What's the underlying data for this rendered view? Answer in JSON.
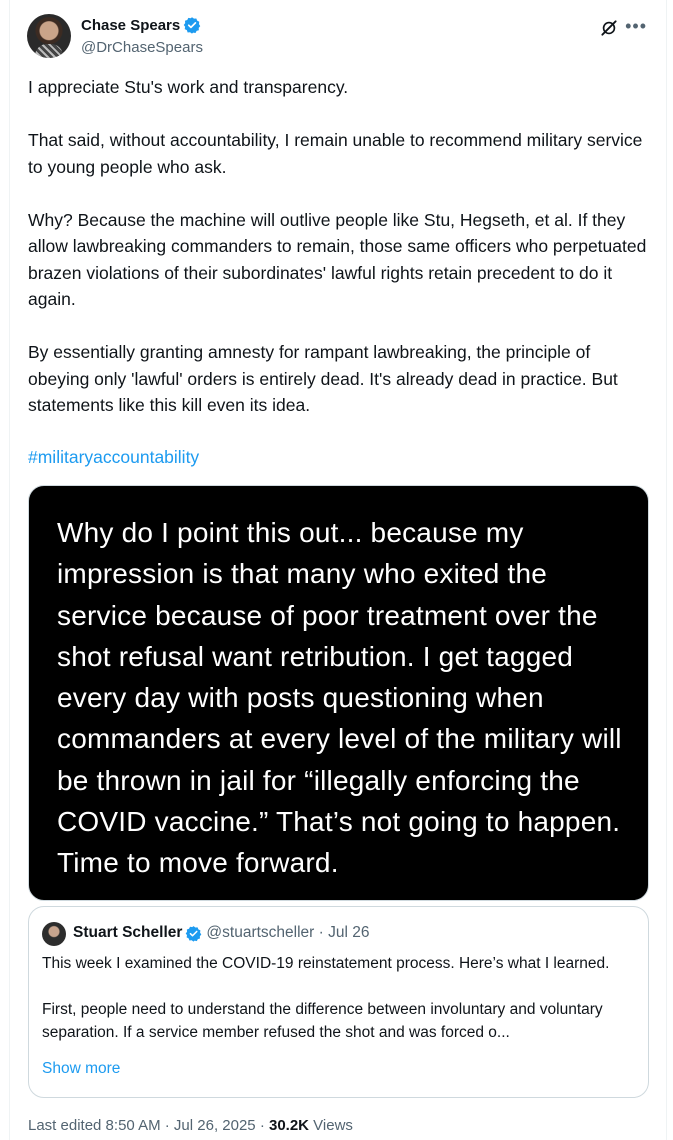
{
  "author": {
    "display_name": "Chase Spears",
    "handle": "@DrChaseSpears"
  },
  "tweet": {
    "paragraphs": [
      "I appreciate Stu's work and transparency.",
      "That said, without accountability, I remain unable to recommend military service to young people who ask.",
      "Why? Because the machine will outlive people like Stu, Hegseth, et al. If they allow lawbreaking commanders to remain, those same officers who perpetuated brazen violations of their subordinates' lawful rights retain precedent to do it again.",
      "By essentially granting amnesty for rampant lawbreaking, the principle of obeying only 'lawful' orders is entirely dead. It's already dead in practice. But statements like this kill even its idea."
    ],
    "hashtag": "#militaryaccountability"
  },
  "media": {
    "text": "Why do I point this out... because my impression is that many who exited the service because of poor treatment over the shot refusal want retribution. I get tagged every day with posts questioning when commanders at every level of the military will be thrown in jail for “illegally enforcing the COVID vaccine.” That’s not going to happen. Time to move forward."
  },
  "quote": {
    "display_name": "Stuart Scheller",
    "meta": "@stuartscheller · Jul 26",
    "paragraph_1": "This week I examined the COVID-19 reinstatement process. Here’s what I learned.",
    "paragraph_2": "First, people need to understand the difference between involuntary and voluntary separation. If a service member refused the shot and was forced o...",
    "show_more": "Show more"
  },
  "footer": {
    "edited": "Last edited 8:50 AM · Jul 26, 2025 · ",
    "views_count": "30.2K",
    "views_label": " Views"
  },
  "icons": {
    "verified": "verified-badge-icon",
    "grok": "grok-icon",
    "more": "more-icon"
  },
  "colors": {
    "accent": "#1d9bf0",
    "text": "#0f1419",
    "muted": "#536471",
    "border": "#cfd9de"
  }
}
